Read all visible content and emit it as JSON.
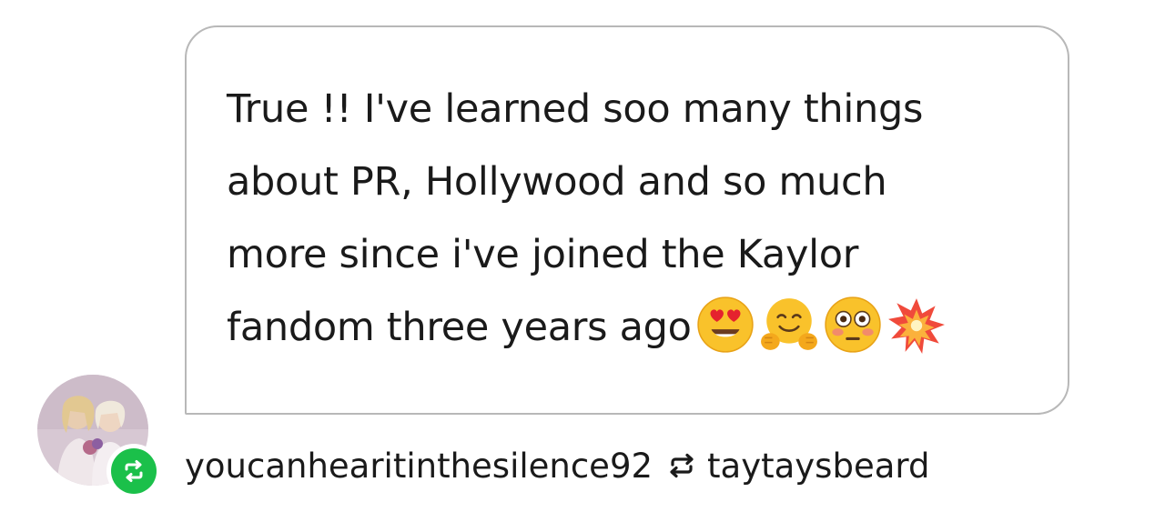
{
  "message": {
    "lines": [
      "True !! I've learned soo many things",
      "about PR, Hollywood and so much",
      "more since i've joined the Kaylor",
      "fandom three years ago"
    ],
    "emojis": [
      "heart-eyes-emoji",
      "hugging-emoji",
      "flushed-emoji",
      "collision-emoji"
    ]
  },
  "byline": {
    "reblogger": "youcanhearitinthesilence92",
    "source": "taytaysbeard"
  },
  "colors": {
    "badge_green": "#1bc04a",
    "border": "#b8b8b8",
    "text": "#1a1a1a"
  }
}
